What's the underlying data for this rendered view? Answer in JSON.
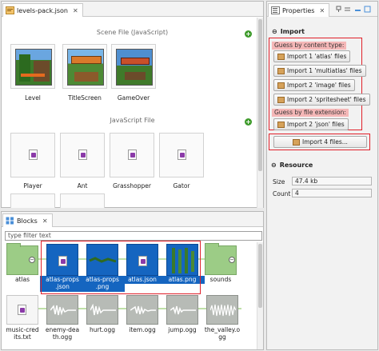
{
  "editor": {
    "tab_title": "levels-pack.json",
    "scene_section": "Scene File (JavaScript)",
    "scenes": [
      {
        "label": "Level"
      },
      {
        "label": "TitleScreen"
      },
      {
        "label": "GameOver"
      }
    ],
    "js_section": "JavaScript File",
    "js_files": [
      {
        "label": "Player"
      },
      {
        "label": "Ant"
      },
      {
        "label": "Grasshopper"
      },
      {
        "label": "Gator"
      }
    ]
  },
  "blocks": {
    "tab_title": "Blocks",
    "filter_placeholder": "type filter text",
    "row1": [
      {
        "label": "atlas",
        "kind": "folder"
      },
      {
        "label": "atlas-props\n.json",
        "kind": "json-selected"
      },
      {
        "label": "atlas-props\n.png",
        "kind": "png-selected"
      },
      {
        "label": "atlas.json",
        "kind": "json-selected"
      },
      {
        "label": "atlas.png",
        "kind": "png-selected"
      },
      {
        "label": "sounds",
        "kind": "folder"
      }
    ],
    "row2": [
      {
        "label": "music-cred\nits.txt",
        "kind": "text"
      },
      {
        "label": "enemy-dea\nth.ogg",
        "kind": "audio"
      },
      {
        "label": "hurt.ogg",
        "kind": "audio"
      },
      {
        "label": "item.ogg",
        "kind": "audio"
      },
      {
        "label": "jump.ogg",
        "kind": "audio"
      },
      {
        "label": "the_valley.o\ngg",
        "kind": "audio"
      }
    ]
  },
  "properties": {
    "tab_title": "Properties",
    "import_section": "Import",
    "guess_by_type": "Guess by content type:",
    "type_buttons": [
      "Import 1 'atlas' files",
      "Import 1 'multiatlas' files",
      "Import 2 'image' files",
      "Import 2 'spritesheet' files"
    ],
    "guess_by_ext": "Guess by file extension:",
    "ext_buttons": [
      "Import 2 'json' files"
    ],
    "import_all": "Import 4 files...",
    "resource_section": "Resource",
    "size_label": "Size",
    "size_value": "47.4 kb",
    "count_label": "Count",
    "count_value": "4"
  },
  "colors": {
    "selection": "#1565c0",
    "highlight": "#e0202a",
    "folder": "#9ccc86",
    "add": "#3d9a2a"
  }
}
